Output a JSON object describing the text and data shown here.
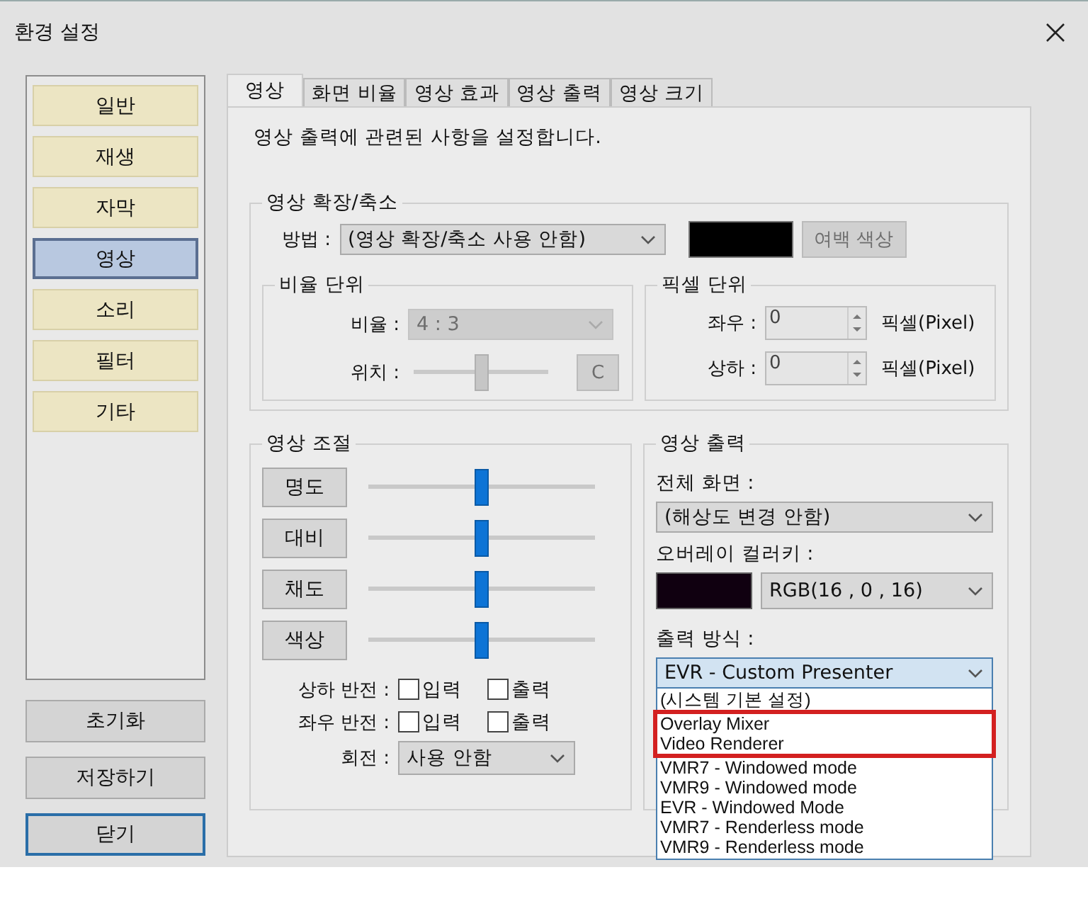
{
  "window": {
    "title": "환경 설정"
  },
  "sidebar": {
    "items": [
      {
        "label": "일반",
        "selected": false
      },
      {
        "label": "재생",
        "selected": false
      },
      {
        "label": "자막",
        "selected": false
      },
      {
        "label": "영상",
        "selected": true
      },
      {
        "label": "소리",
        "selected": false
      },
      {
        "label": "필터",
        "selected": false
      },
      {
        "label": "기타",
        "selected": false
      }
    ],
    "buttons": [
      {
        "label": "초기화",
        "focused": false
      },
      {
        "label": "저장하기",
        "focused": false
      },
      {
        "label": "닫기",
        "focused": true
      }
    ]
  },
  "tabs": [
    {
      "label": "영상",
      "selected": true
    },
    {
      "label": "화면 비율",
      "selected": false
    },
    {
      "label": "영상 효과",
      "selected": false
    },
    {
      "label": "영상 출력",
      "selected": false
    },
    {
      "label": "영상 크기",
      "selected": false
    }
  ],
  "description": "영상 출력에 관련된 사항을 설정합니다.",
  "scaling": {
    "title": "영상 확장/축소",
    "method_label": "방법 :",
    "method_value": "(영상 확장/축소 사용 안함)",
    "color_button": {
      "label": "여백 색상",
      "disabled": true
    }
  },
  "ratio": {
    "title": "비율 단위",
    "ratio_label": "비율 :",
    "ratio_value": "4 : 3",
    "disabled": true,
    "position_label": "위치 :",
    "position": {
      "level": 0.5
    },
    "reset_button": "C"
  },
  "pixel": {
    "title": "픽셀 단위",
    "fields": [
      {
        "label": "좌우 :",
        "value": "0",
        "unit": "픽셀(Pixel)"
      },
      {
        "label": "상하 :",
        "value": "0",
        "unit": "픽셀(Pixel)"
      }
    ]
  },
  "adjust": {
    "title": "영상 조절",
    "sliders": [
      {
        "label": "명도",
        "level": 0.5
      },
      {
        "label": "대비",
        "level": 0.5
      },
      {
        "label": "채도",
        "level": 0.5
      },
      {
        "label": "색상",
        "level": 0.5
      }
    ],
    "flips": [
      {
        "label": "상하 반전 :",
        "options": [
          {
            "label": "입력",
            "checked": false
          },
          {
            "label": "출력",
            "checked": false
          }
        ]
      },
      {
        "label": "좌우 반전 :",
        "options": [
          {
            "label": "입력",
            "checked": false
          },
          {
            "label": "출력",
            "checked": false
          }
        ]
      }
    ],
    "rotation": {
      "label": "회전 :",
      "value": "사용 안함"
    }
  },
  "output": {
    "title": "영상 출력",
    "fullscreen": {
      "label": "전체 화면 :",
      "value": "(해상도 변경 안함)"
    },
    "colorkey": {
      "label": "오버레이 컬러키 :",
      "value": "RGB(16 , 0 , 16)"
    },
    "method": {
      "label": "출력 방식 :",
      "value": "EVR - Custom Presenter",
      "expanded": true,
      "options": [
        {
          "label": "(시스템 기본 설정)",
          "highlighted": false
        },
        {
          "label": "Overlay Mixer",
          "highlighted": true
        },
        {
          "label": "Video Renderer",
          "highlighted": true
        },
        {
          "label": "VMR7 - Windowed mode",
          "highlighted": false
        },
        {
          "label": "VMR9 - Windowed mode",
          "highlighted": false
        },
        {
          "label": "EVR - Windowed Mode",
          "highlighted": false
        },
        {
          "label": "VMR7 - Renderless mode",
          "highlighted": false
        },
        {
          "label": "VMR9 - Renderless mode",
          "highlighted": false
        }
      ]
    }
  }
}
